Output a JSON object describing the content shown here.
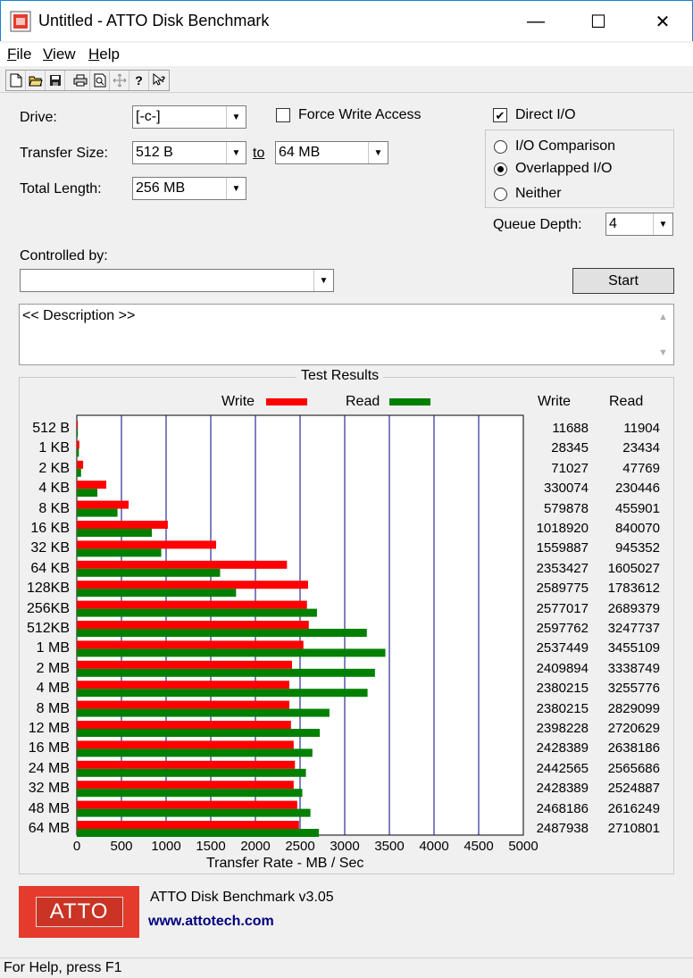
{
  "window": {
    "title": "Untitled - ATTO Disk Benchmark",
    "minimize_glyph": "—",
    "maximize_glyph": "☐",
    "close_glyph": "✕"
  },
  "menu": [
    {
      "label": "File",
      "key": "F",
      "rest": "ile"
    },
    {
      "label": "View",
      "key": "V",
      "rest": "iew"
    },
    {
      "label": "Help",
      "key": "H",
      "rest": "elp"
    }
  ],
  "toolbar": {
    "icons": [
      "new-file-icon",
      "open-folder-icon",
      "save-icon",
      "print-icon",
      "print-preview-icon",
      "move-icon",
      "help-icon",
      "context-help-icon"
    ]
  },
  "settings": {
    "drive_label": "Drive:",
    "drive_value": "[-c-]",
    "transfer_size_label": "Transfer Size:",
    "transfer_from": "512 B",
    "to_label": "to",
    "transfer_to": "64 MB",
    "total_length_label": "Total Length:",
    "total_length_value": "256 MB",
    "force_write_label": "Force Write Access",
    "force_write_checked": false,
    "direct_io_label": "Direct I/O",
    "direct_io_checked": true,
    "io_options": [
      {
        "label": "I/O Comparison",
        "selected": false
      },
      {
        "label": "Overlapped I/O",
        "selected": true
      },
      {
        "label": "Neither",
        "selected": false
      }
    ],
    "queue_depth_label": "Queue Depth:",
    "queue_depth_value": "4",
    "controlled_by_label": "Controlled by:",
    "controlled_by_value": "",
    "start_label": "Start",
    "description": "<< Description >>"
  },
  "results": {
    "group_title": "Test Results",
    "write_col": "Write",
    "read_col": "Read",
    "rows": [
      {
        "size": "512 B",
        "write": "11688",
        "read": "11904"
      },
      {
        "size": "1 KB",
        "write": "28345",
        "read": "23434"
      },
      {
        "size": "2 KB",
        "write": "71027",
        "read": "47769"
      },
      {
        "size": "4 KB",
        "write": "330074",
        "read": "230446"
      },
      {
        "size": "8 KB",
        "write": "579878",
        "read": "455901"
      },
      {
        "size": "16 KB",
        "write": "1018920",
        "read": "840070"
      },
      {
        "size": "32 KB",
        "write": "1559887",
        "read": "945352"
      },
      {
        "size": "64 KB",
        "write": "2353427",
        "read": "1605027"
      },
      {
        "size": "128KB",
        "write": "2589775",
        "read": "1783612"
      },
      {
        "size": "256KB",
        "write": "2577017",
        "read": "2689379"
      },
      {
        "size": "512KB",
        "write": "2597762",
        "read": "3247737"
      },
      {
        "size": "1 MB",
        "write": "2537449",
        "read": "3455109"
      },
      {
        "size": "2 MB",
        "write": "2409894",
        "read": "3338749"
      },
      {
        "size": "4 MB",
        "write": "2380215",
        "read": "3255776"
      },
      {
        "size": "8 MB",
        "write": "2380215",
        "read": "2829099"
      },
      {
        "size": "12 MB",
        "write": "2398228",
        "read": "2720629"
      },
      {
        "size": "16 MB",
        "write": "2428389",
        "read": "2638186"
      },
      {
        "size": "24 MB",
        "write": "2442565",
        "read": "2565686"
      },
      {
        "size": "32 MB",
        "write": "2428389",
        "read": "2524887"
      },
      {
        "size": "48 MB",
        "write": "2468186",
        "read": "2616249"
      },
      {
        "size": "64 MB",
        "write": "2487938",
        "read": "2710801"
      }
    ]
  },
  "chart_data": {
    "type": "bar",
    "orientation": "horizontal",
    "title": "",
    "xlabel": "Transfer Rate - MB / Sec",
    "ylabel": "",
    "xlim": [
      0,
      5000
    ],
    "xticks": [
      "0",
      "500",
      "1000",
      "1500",
      "2000",
      "2500",
      "3000",
      "3500",
      "4000",
      "4500",
      "5000"
    ],
    "legend_position": "top",
    "grid": true,
    "categories": [
      "512 B",
      "1 KB",
      "2 KB",
      "4 KB",
      "8 KB",
      "16 KB",
      "32 KB",
      "64 KB",
      "128KB",
      "256KB",
      "512KB",
      "1 MB",
      "2 MB",
      "4 MB",
      "8 MB",
      "12 MB",
      "16 MB",
      "24 MB",
      "32 MB",
      "48 MB",
      "64 MB"
    ],
    "series": [
      {
        "name": "Write",
        "color": "#ff0000",
        "values": [
          11.7,
          28.3,
          71.0,
          330.1,
          579.9,
          1018.9,
          1559.9,
          2353.4,
          2589.8,
          2577.0,
          2597.8,
          2537.4,
          2409.9,
          2380.2,
          2380.2,
          2398.2,
          2428.4,
          2442.6,
          2428.4,
          2468.2,
          2487.9
        ]
      },
      {
        "name": "Read",
        "color": "#008000",
        "values": [
          11.9,
          23.4,
          47.8,
          230.4,
          455.9,
          840.1,
          945.4,
          1605.0,
          1783.6,
          2689.4,
          3247.7,
          3455.1,
          3338.7,
          3255.8,
          2829.1,
          2720.6,
          2638.2,
          2565.7,
          2524.9,
          2616.2,
          2710.8
        ]
      }
    ]
  },
  "footer": {
    "logo_text": "ATTO",
    "product": "ATTO Disk Benchmark v3.05",
    "url": "www.attotech.com",
    "status": "For Help, press F1"
  },
  "colors": {
    "accent": "#1883d7",
    "logo_bg": "#e53b2c",
    "link": "#000080",
    "grid": "#000080"
  }
}
